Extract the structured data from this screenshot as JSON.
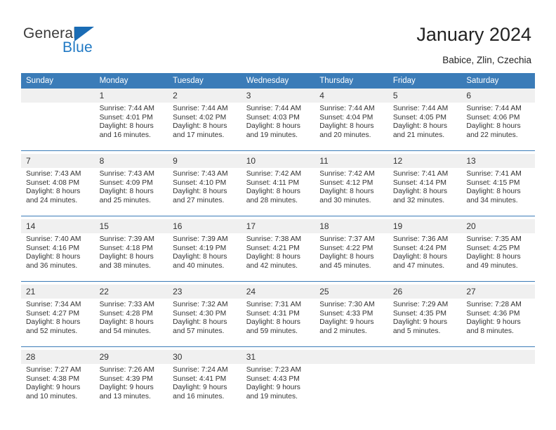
{
  "brand": {
    "name_part1": "General",
    "name_part2": "Blue",
    "triangle_icon": "triangle-icon",
    "accent_color": "#2079c4"
  },
  "header": {
    "title": "January 2024",
    "subtitle": "Babice, Zlin, Czechia"
  },
  "calendar": {
    "header_bg_color": "#3b7cb8",
    "daynum_bg_color": "#f0f0f0",
    "weekdays": [
      "Sunday",
      "Monday",
      "Tuesday",
      "Wednesday",
      "Thursday",
      "Friday",
      "Saturday"
    ],
    "weeks": [
      {
        "days": [
          {
            "num": "",
            "lines": []
          },
          {
            "num": "1",
            "lines": [
              "Sunrise: 7:44 AM",
              "Sunset: 4:01 PM",
              "Daylight: 8 hours",
              "and 16 minutes."
            ]
          },
          {
            "num": "2",
            "lines": [
              "Sunrise: 7:44 AM",
              "Sunset: 4:02 PM",
              "Daylight: 8 hours",
              "and 17 minutes."
            ]
          },
          {
            "num": "3",
            "lines": [
              "Sunrise: 7:44 AM",
              "Sunset: 4:03 PM",
              "Daylight: 8 hours",
              "and 19 minutes."
            ]
          },
          {
            "num": "4",
            "lines": [
              "Sunrise: 7:44 AM",
              "Sunset: 4:04 PM",
              "Daylight: 8 hours",
              "and 20 minutes."
            ]
          },
          {
            "num": "5",
            "lines": [
              "Sunrise: 7:44 AM",
              "Sunset: 4:05 PM",
              "Daylight: 8 hours",
              "and 21 minutes."
            ]
          },
          {
            "num": "6",
            "lines": [
              "Sunrise: 7:44 AM",
              "Sunset: 4:06 PM",
              "Daylight: 8 hours",
              "and 22 minutes."
            ]
          }
        ]
      },
      {
        "days": [
          {
            "num": "7",
            "lines": [
              "Sunrise: 7:43 AM",
              "Sunset: 4:08 PM",
              "Daylight: 8 hours",
              "and 24 minutes."
            ]
          },
          {
            "num": "8",
            "lines": [
              "Sunrise: 7:43 AM",
              "Sunset: 4:09 PM",
              "Daylight: 8 hours",
              "and 25 minutes."
            ]
          },
          {
            "num": "9",
            "lines": [
              "Sunrise: 7:43 AM",
              "Sunset: 4:10 PM",
              "Daylight: 8 hours",
              "and 27 minutes."
            ]
          },
          {
            "num": "10",
            "lines": [
              "Sunrise: 7:42 AM",
              "Sunset: 4:11 PM",
              "Daylight: 8 hours",
              "and 28 minutes."
            ]
          },
          {
            "num": "11",
            "lines": [
              "Sunrise: 7:42 AM",
              "Sunset: 4:12 PM",
              "Daylight: 8 hours",
              "and 30 minutes."
            ]
          },
          {
            "num": "12",
            "lines": [
              "Sunrise: 7:41 AM",
              "Sunset: 4:14 PM",
              "Daylight: 8 hours",
              "and 32 minutes."
            ]
          },
          {
            "num": "13",
            "lines": [
              "Sunrise: 7:41 AM",
              "Sunset: 4:15 PM",
              "Daylight: 8 hours",
              "and 34 minutes."
            ]
          }
        ]
      },
      {
        "days": [
          {
            "num": "14",
            "lines": [
              "Sunrise: 7:40 AM",
              "Sunset: 4:16 PM",
              "Daylight: 8 hours",
              "and 36 minutes."
            ]
          },
          {
            "num": "15",
            "lines": [
              "Sunrise: 7:39 AM",
              "Sunset: 4:18 PM",
              "Daylight: 8 hours",
              "and 38 minutes."
            ]
          },
          {
            "num": "16",
            "lines": [
              "Sunrise: 7:39 AM",
              "Sunset: 4:19 PM",
              "Daylight: 8 hours",
              "and 40 minutes."
            ]
          },
          {
            "num": "17",
            "lines": [
              "Sunrise: 7:38 AM",
              "Sunset: 4:21 PM",
              "Daylight: 8 hours",
              "and 42 minutes."
            ]
          },
          {
            "num": "18",
            "lines": [
              "Sunrise: 7:37 AM",
              "Sunset: 4:22 PM",
              "Daylight: 8 hours",
              "and 45 minutes."
            ]
          },
          {
            "num": "19",
            "lines": [
              "Sunrise: 7:36 AM",
              "Sunset: 4:24 PM",
              "Daylight: 8 hours",
              "and 47 minutes."
            ]
          },
          {
            "num": "20",
            "lines": [
              "Sunrise: 7:35 AM",
              "Sunset: 4:25 PM",
              "Daylight: 8 hours",
              "and 49 minutes."
            ]
          }
        ]
      },
      {
        "days": [
          {
            "num": "21",
            "lines": [
              "Sunrise: 7:34 AM",
              "Sunset: 4:27 PM",
              "Daylight: 8 hours",
              "and 52 minutes."
            ]
          },
          {
            "num": "22",
            "lines": [
              "Sunrise: 7:33 AM",
              "Sunset: 4:28 PM",
              "Daylight: 8 hours",
              "and 54 minutes."
            ]
          },
          {
            "num": "23",
            "lines": [
              "Sunrise: 7:32 AM",
              "Sunset: 4:30 PM",
              "Daylight: 8 hours",
              "and 57 minutes."
            ]
          },
          {
            "num": "24",
            "lines": [
              "Sunrise: 7:31 AM",
              "Sunset: 4:31 PM",
              "Daylight: 8 hours",
              "and 59 minutes."
            ]
          },
          {
            "num": "25",
            "lines": [
              "Sunrise: 7:30 AM",
              "Sunset: 4:33 PM",
              "Daylight: 9 hours",
              "and 2 minutes."
            ]
          },
          {
            "num": "26",
            "lines": [
              "Sunrise: 7:29 AM",
              "Sunset: 4:35 PM",
              "Daylight: 9 hours",
              "and 5 minutes."
            ]
          },
          {
            "num": "27",
            "lines": [
              "Sunrise: 7:28 AM",
              "Sunset: 4:36 PM",
              "Daylight: 9 hours",
              "and 8 minutes."
            ]
          }
        ]
      },
      {
        "days": [
          {
            "num": "28",
            "lines": [
              "Sunrise: 7:27 AM",
              "Sunset: 4:38 PM",
              "Daylight: 9 hours",
              "and 10 minutes."
            ]
          },
          {
            "num": "29",
            "lines": [
              "Sunrise: 7:26 AM",
              "Sunset: 4:39 PM",
              "Daylight: 9 hours",
              "and 13 minutes."
            ]
          },
          {
            "num": "30",
            "lines": [
              "Sunrise: 7:24 AM",
              "Sunset: 4:41 PM",
              "Daylight: 9 hours",
              "and 16 minutes."
            ]
          },
          {
            "num": "31",
            "lines": [
              "Sunrise: 7:23 AM",
              "Sunset: 4:43 PM",
              "Daylight: 9 hours",
              "and 19 minutes."
            ]
          },
          {
            "num": "",
            "lines": []
          },
          {
            "num": "",
            "lines": []
          },
          {
            "num": "",
            "lines": []
          }
        ]
      }
    ]
  }
}
